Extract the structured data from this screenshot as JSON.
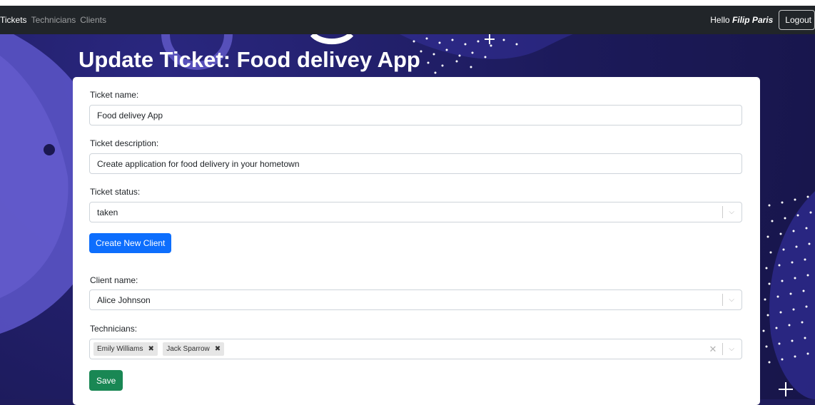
{
  "nav": {
    "links": [
      "Tickets",
      "Technicians",
      "Clients"
    ],
    "greeting_prefix": "Hello",
    "user_name": "Filip Paris",
    "logout_label": "Logout"
  },
  "page": {
    "title": "Update Ticket: Food delivey App"
  },
  "form": {
    "ticket_name_label": "Ticket name:",
    "ticket_name_value": "Food delivey App",
    "ticket_description_label": "Ticket description:",
    "ticket_description_value": "Create application for food delivery in your hometown",
    "ticket_status_label": "Ticket status:",
    "ticket_status_value": "taken",
    "create_client_label": "Create New Client",
    "client_name_label": "Client name:",
    "client_name_value": "Alice Johnson",
    "technicians_label": "Technicians:",
    "technicians_selected": [
      "Emily Williams",
      "Jack Sparrow"
    ],
    "save_label": "Save"
  },
  "colors": {
    "navbar": "#212529",
    "primary": "#0d6efd",
    "success": "#198754",
    "background": "#1f1c5c"
  }
}
